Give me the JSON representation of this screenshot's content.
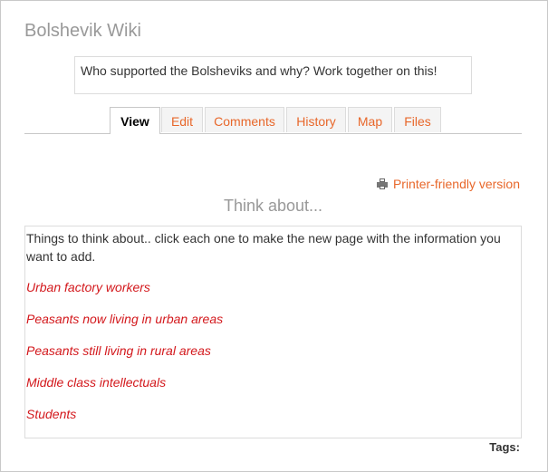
{
  "wiki": {
    "title": "Bolshevik Wiki",
    "intro": "Who supported the Bolsheviks and why? Work together on this!"
  },
  "tabs": [
    {
      "label": "View"
    },
    {
      "label": "Edit"
    },
    {
      "label": "Comments"
    },
    {
      "label": "History"
    },
    {
      "label": "Map"
    },
    {
      "label": "Files"
    }
  ],
  "actions": {
    "printer_friendly": "Printer-friendly version"
  },
  "page": {
    "title": "Think about...",
    "intro": "Things to think about.. click each one to make the new page with the information you want to add.",
    "links": [
      "Urban factory workers",
      "Peasants now living in urban areas",
      "Peasants still living in rural areas",
      "Middle class intellectuals",
      "Students"
    ]
  },
  "footer": {
    "tags_label": "Tags:"
  },
  "colors": {
    "accent": "#e8672a",
    "link": "#d3181c",
    "title_gray": "#999999"
  }
}
